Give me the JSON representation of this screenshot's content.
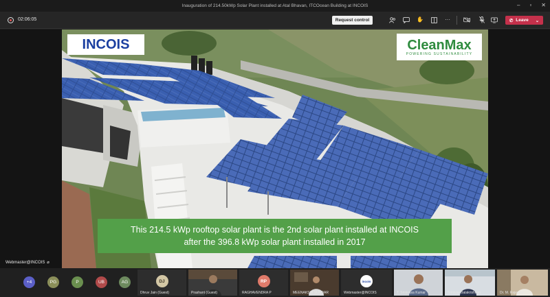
{
  "window": {
    "title": "Inauguration of 214.50kWp Solar Plant installed at Atal Bhavan, ITCOcean Building at INCOIS"
  },
  "toolbar": {
    "timer": "02:06:05",
    "request_control_label": "Request control",
    "leave_label": "Leave",
    "icons": [
      "people-icon",
      "chat-icon",
      "raise-hand-icon",
      "rooms-icon",
      "more-icon",
      "camera-icon",
      "mic-icon",
      "share-icon"
    ]
  },
  "presentation": {
    "logo_left": "INCOIS",
    "logo_right_name": "CleanMax",
    "logo_right_tagline": "POWERING SUSTAINABILITY",
    "caption_line1": "This 214.5 kWp rooftop solar plant is the 2nd solar plant installed at INCOIS",
    "caption_line2": "after the 396.8 kWp solar plant installed in 2017",
    "presenter": "Webmaster@INCOIS"
  },
  "participants": {
    "overflow": "+4",
    "avatars": [
      {
        "initials": "PG",
        "color": "#8b8f5a"
      },
      {
        "initials": "P",
        "color": "#6a8f4f"
      },
      {
        "initials": "UB",
        "color": "#b04a4a"
      },
      {
        "initials": "AG",
        "color": "#6d8a5e"
      }
    ],
    "tiles": [
      {
        "initials": "DJ",
        "name": "Dhruv Jain (Guest)",
        "type": "initials"
      },
      {
        "initials": "",
        "name": "Prashant (Guest)",
        "type": "camera"
      },
      {
        "initials": "RP",
        "name": "RAGHAVENDRA P",
        "type": "initials"
      },
      {
        "initials": "",
        "name": "MEENAKSHI SUNDAR",
        "type": "camera"
      },
      {
        "initials": "",
        "name": "Webmaster@INCOIS",
        "type": "logo"
      },
      {
        "initials": "",
        "name": "T. Srinivasa Kumar",
        "type": "camera"
      },
      {
        "initials": "",
        "name": "Srinivas Balakrishnan",
        "type": "camera"
      },
      {
        "initials": "",
        "name": "Dr. M. Rajeevan",
        "type": "camera"
      }
    ]
  },
  "colors": {
    "leave": "#c4314b",
    "caption_bg": "#53a049",
    "incois_blue": "#1b3fa0",
    "cleanmax_green": "#2e8b3e"
  }
}
